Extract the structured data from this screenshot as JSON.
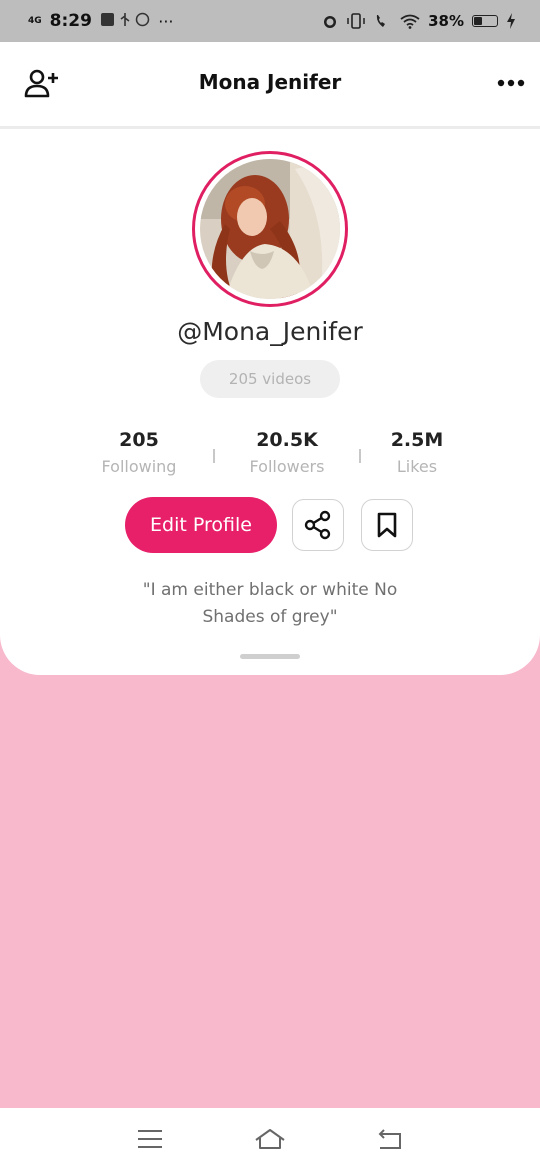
{
  "status_bar": {
    "network": "4G",
    "time": "8:29",
    "more": "···",
    "battery": "38%",
    "battery_level": 0.38
  },
  "header": {
    "title": "Mona Jenifer"
  },
  "profile": {
    "username": "@Mona_Jenifer",
    "videos": "205 videos",
    "stats": [
      {
        "value": "205",
        "label": "Following"
      },
      {
        "value": "20.5K",
        "label": "Followers"
      },
      {
        "value": "2.5M",
        "label": "Likes"
      }
    ],
    "edit_button": "Edit Profile",
    "bio": "\"I am either black or white No Shades of grey\""
  },
  "colors": {
    "accent": "#e8206a",
    "background": "#f8b9cd"
  },
  "icons": [
    "add-user-icon",
    "more-icon",
    "share-icon",
    "bookmark-icon",
    "menu-icon",
    "home-icon",
    "back-icon"
  ]
}
